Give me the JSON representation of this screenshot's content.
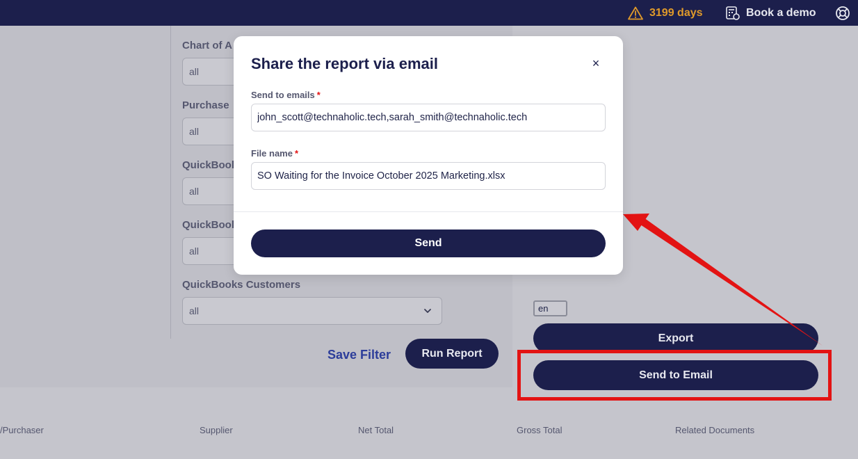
{
  "topbar": {
    "days": "3199 days",
    "book_demo": "Book a demo",
    "colors": {
      "background": "#1c1f4c",
      "warning": "#e09a2a"
    }
  },
  "filters": [
    {
      "label": "Chart of A",
      "value": "all"
    },
    {
      "label": "Purchase",
      "value": "all"
    },
    {
      "label": "QuickBook",
      "value": "all"
    },
    {
      "label": "QuickBook",
      "value": "all"
    },
    {
      "label": "QuickBooks Customers",
      "value": "all"
    }
  ],
  "actions": {
    "save_filter": "Save Filter",
    "run_report": "Run Report",
    "language": "en",
    "export": "Export",
    "send_to_email": "Send to Email"
  },
  "table": {
    "columns": [
      "/Purchaser",
      "Supplier",
      "Net Total",
      "Gross Total",
      "Related Documents"
    ]
  },
  "modal": {
    "title": "Share the report via email",
    "close_symbol": "×",
    "emails_label": "Send to emails",
    "emails_value": "john_scott@technaholic.tech,sarah_smith@technaholic.tech",
    "filename_label": "File name",
    "filename_value": "SO Waiting for the Invoice October 2025 Marketing.xlsx",
    "required_mark": "*",
    "send": "Send"
  },
  "annotation": {
    "highlight_color": "#e31313"
  }
}
